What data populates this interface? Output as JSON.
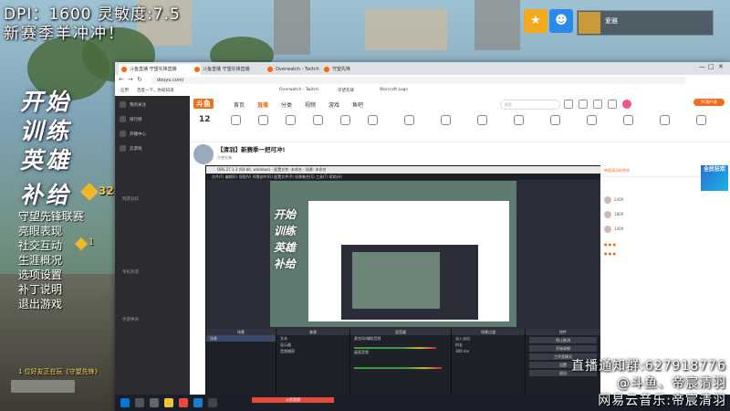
{
  "overlay": {
    "dpi_line": "DPI：1600 灵敏度:7.5",
    "slogan": "新赛季羊冲冲！"
  },
  "game_menu": {
    "big_items": [
      "开始",
      "训练",
      "英雄",
      "补给"
    ],
    "supply_count": "32",
    "items": [
      "守望先锋联赛",
      "亮眼表现",
      "社交互动",
      "生涯概况",
      "选项设置",
      "补丁说明",
      "退出游戏"
    ],
    "social_count": "1",
    "friend_online": "1 位好友正在玩《守望先锋》"
  },
  "hud": {
    "player_name": "爱雅",
    "icons": [
      "team-icon",
      "group-icon"
    ]
  },
  "browser": {
    "tabs": [
      "斗鱼直播 守望先锋直播",
      "斗鱼直播 守望先锋直播",
      "Overwatch - Twitch",
      "守望先锋"
    ],
    "url": "douyu.com/",
    "bookmarks": [
      "应用",
      "百度一下，你就知道",
      "Overwatch - Twitch",
      "守望先锋",
      "Warcraft Logs"
    ]
  },
  "douyu": {
    "sidebar_items": [
      "我的关注",
      "排行榜",
      "开播中心",
      "云游戏"
    ],
    "sidebar_sections": [
      "网游竞技",
      "单机热游",
      "手游休闲"
    ],
    "sidebar_buttons": [
      "客户端下载",
      "开播"
    ],
    "nav": [
      "首页",
      "直播",
      "分类",
      "视频",
      "游戏",
      "鱼吧"
    ],
    "search_placeholder": "搜索",
    "pc_button": "PC客户端",
    "follow_count": "12",
    "room_title": "【清羽】新赛季一把可冲!",
    "room_sub": "守望先锋",
    "chat_header": "帝宸清羽的贵宾",
    "promo": "全民狂欢",
    "ranks": [
      "2400",
      "1800",
      "1400"
    ]
  },
  "obs": {
    "title": "OBS 27.1.3 (64-bit, windows) - 配置文件: 未命名 - 场景: 未命名",
    "menu": "文件(F)  编辑(E)  视图(V)  停靠部件(D)  配置文件(P)  场景集合(S)  工具(T)  帮助(H)",
    "preview_text": [
      "开始",
      "训练",
      "英雄",
      "补给"
    ],
    "docks": {
      "scenes_header": "场景",
      "scenes": [
        "场景"
      ],
      "sources_header": "来源",
      "sources": [
        "文本",
        "显示器",
        "音频捕获"
      ],
      "mixer_header": "混音器",
      "mixer": [
        "麦克风/辅助音频",
        "桌面音频"
      ],
      "transition_header": "场景过渡",
      "transition_value": "淡入淡出",
      "duration_label": "时长",
      "duration_value": "300 ms",
      "controls_header": "控件",
      "controls": [
        "停止推流",
        "开始录制",
        "工作室模式",
        "设置",
        "退出"
      ]
    },
    "status": "LIVE: 00:00:00  REC: 00:00:00  CPU: 1.3%, 60.00 fps"
  },
  "taskbar": {
    "active_title": "斗鱼直播"
  },
  "stream_info": {
    "line1": "直播通知群:627918776",
    "line2": "@斗鱼、帝宸清羽",
    "line3": "网易云音乐:帝宸清羽"
  }
}
